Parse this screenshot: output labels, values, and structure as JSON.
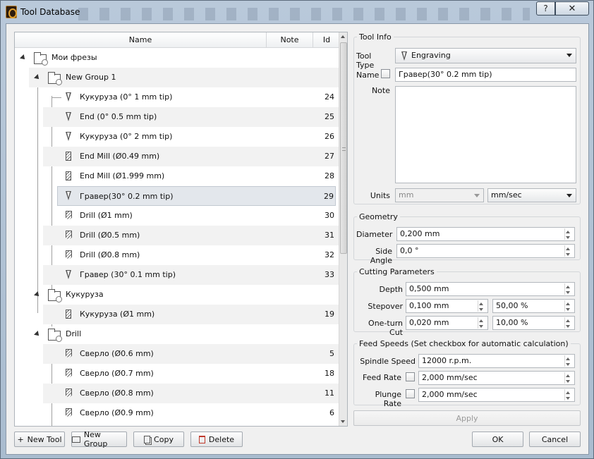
{
  "window": {
    "title": "Tool Database",
    "help_label": "?",
    "close_label": "✕"
  },
  "tree": {
    "headers": {
      "name": "Name",
      "note": "Note",
      "id": "Id"
    },
    "root": {
      "label": "Мои фрезы"
    },
    "groups": [
      {
        "label": "New Group 1"
      },
      {
        "label": "Кукуруза"
      },
      {
        "label": "Drill"
      }
    ],
    "tools": [
      {
        "label": "Кукуруза (0° 1 mm tip)",
        "id": "24",
        "icon": "v-bit-icon"
      },
      {
        "label": "End (0° 0.5 mm tip)",
        "id": "25",
        "icon": "v-bit-icon"
      },
      {
        "label": "Кукуруза (0° 2 mm tip)",
        "id": "26",
        "icon": "v-bit-icon"
      },
      {
        "label": "End Mill (Ø0.49 mm)",
        "id": "27",
        "icon": "end-mill-icon"
      },
      {
        "label": "End Mill (Ø1.999 mm)",
        "id": "28",
        "icon": "end-mill-icon"
      },
      {
        "label": "Гравер(30° 0.2 mm tip)",
        "id": "29",
        "icon": "v-bit-icon"
      },
      {
        "label": "Drill (Ø1 mm)",
        "id": "30",
        "icon": "drill-icon"
      },
      {
        "label": "Drill (Ø0.5 mm)",
        "id": "31",
        "icon": "drill-icon"
      },
      {
        "label": "Drill (Ø0.8 mm)",
        "id": "32",
        "icon": "drill-icon"
      },
      {
        "label": "Гравер (30° 0.1 mm tip)",
        "id": "33",
        "icon": "v-bit-icon"
      },
      {
        "label": "Кукуруза (Ø1 mm)",
        "id": "19",
        "icon": "end-mill-icon"
      },
      {
        "label": "Сверло (Ø0.6 mm)",
        "id": "5",
        "icon": "drill-icon"
      },
      {
        "label": "Сверло (Ø0.7 mm)",
        "id": "18",
        "icon": "drill-icon"
      },
      {
        "label": "Сверло (Ø0.8 mm)",
        "id": "11",
        "icon": "drill-icon"
      },
      {
        "label": "Сверло (Ø0.9 mm)",
        "id": "6",
        "icon": "drill-icon"
      }
    ]
  },
  "buttons": {
    "new_tool": "New Tool",
    "new_group": "New Group",
    "copy": "Copy",
    "delete": "Delete",
    "apply": "Apply",
    "ok": "OK",
    "cancel": "Cancel"
  },
  "tool_info": {
    "title": "Tool Info",
    "tool_type_label": "Tool Type",
    "tool_type_value": "Engraving",
    "name_label": "Name",
    "name_value": "Гравер(30° 0.2 mm tip)",
    "note_label": "Note",
    "units_label": "Units",
    "units_value": "mm",
    "units_speed_value": "mm/sec"
  },
  "geometry": {
    "title": "Geometry",
    "diameter_label": "Diameter",
    "diameter_value": "0,200 mm",
    "side_angle_label": "Side Angle",
    "side_angle_value": "0,0 °"
  },
  "cutting": {
    "title": "Cutting Parameters",
    "depth_label": "Depth",
    "depth_value": "0,500 mm",
    "stepover_label": "Stepover",
    "stepover_value": "0,100 mm",
    "stepover_pct": "50,00 %",
    "oneturn_label": "One-turn Cut",
    "oneturn_value": "0,020 mm",
    "oneturn_pct": "10,00 %"
  },
  "feeds": {
    "title": "Feed Speeds (Set checkbox for automatic calculation)",
    "spindle_label": "Spindle Speed",
    "spindle_value": "12000 r.p.m.",
    "feed_label": "Feed Rate",
    "feed_value": "2,000 mm/sec",
    "plunge_label": "Plunge Rate",
    "plunge_value": "2,000 mm/sec"
  }
}
